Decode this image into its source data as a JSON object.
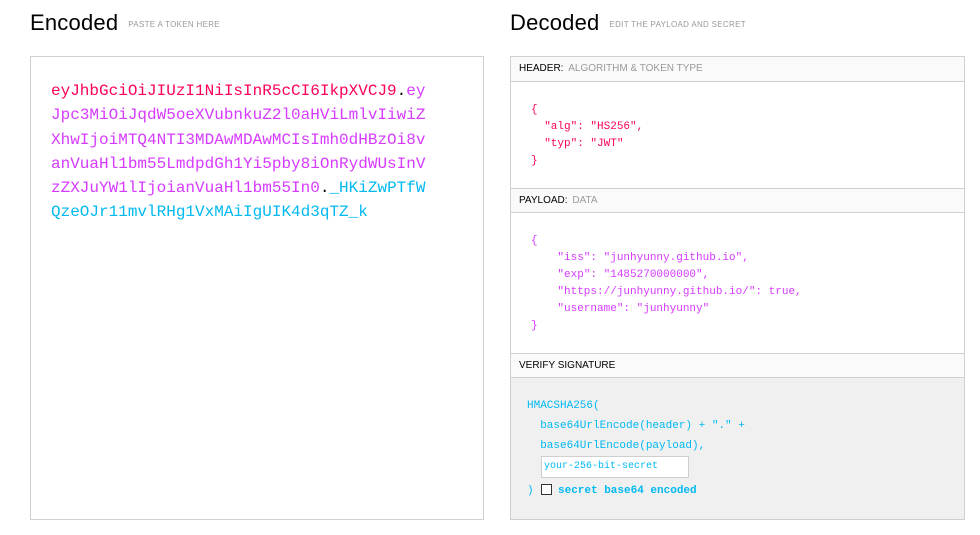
{
  "encoded": {
    "title": "Encoded",
    "subtitle": "PASTE A TOKEN HERE",
    "token_lines": [
      {
        "segments": [
          {
            "text": "eyJhbGciOiJIUzI1NiIsInR5cCI6IkpXVCJ9",
            "part": "header"
          },
          {
            "text": ".",
            "part": "dot"
          },
          {
            "text": "ey",
            "part": "payload"
          }
        ]
      },
      {
        "segments": [
          {
            "text": "Jpc3MiOiJqdW5oeXVubnkuZ2l0aHViLmlvIiwiZ",
            "part": "payload"
          }
        ]
      },
      {
        "segments": [
          {
            "text": "XhwIjoiMTQ4NTI3MDAwMDAwMCIsImh0dHBzOi8v",
            "part": "payload"
          }
        ]
      },
      {
        "segments": [
          {
            "text": "anVuaHl1bm55LmdpdGh1Yi5pby8iOnRydWUsInV",
            "part": "payload"
          }
        ]
      },
      {
        "segments": [
          {
            "text": "zZXJuYW1lIjoianVuaHl1bm55In0",
            "part": "payload"
          },
          {
            "text": ".",
            "part": "dot"
          },
          {
            "text": "_HKiZwPTfW",
            "part": "sig"
          }
        ]
      },
      {
        "segments": [
          {
            "text": "QzeOJr11mvlRHg1VxMAiIgUIK4d3qTZ_k",
            "part": "sig"
          }
        ]
      }
    ]
  },
  "decoded": {
    "title": "Decoded",
    "subtitle": "EDIT THE PAYLOAD AND SECRET",
    "header_section": {
      "label": "HEADER:",
      "sublabel": "ALGORITHM & TOKEN TYPE",
      "lines": [
        "{",
        "  \"alg\": \"HS256\",",
        "  \"typ\": \"JWT\"",
        "}"
      ]
    },
    "payload_section": {
      "label": "PAYLOAD:",
      "sublabel": "DATA",
      "lines": [
        "{",
        "    \"iss\": \"junhyunny.github.io\",",
        "    \"exp\": \"1485270000000\",",
        "    \"https://junhyunny.github.io/\": true,",
        "    \"username\": \"junhyunny\"",
        "}"
      ]
    },
    "verify_section": {
      "label": "VERIFY SIGNATURE",
      "fn_open": "HMACSHA256(",
      "line1": "  base64UrlEncode(header) + \".\" +",
      "line2": "  base64UrlEncode(payload),",
      "secret_value": "your-256-bit-secret",
      "close_paren": ")",
      "checkbox_label": "secret base64 encoded",
      "checkbox_checked": false
    }
  },
  "colors": {
    "header": "#fb015b",
    "payload": "#d63aff",
    "signature": "#00b9f1"
  }
}
